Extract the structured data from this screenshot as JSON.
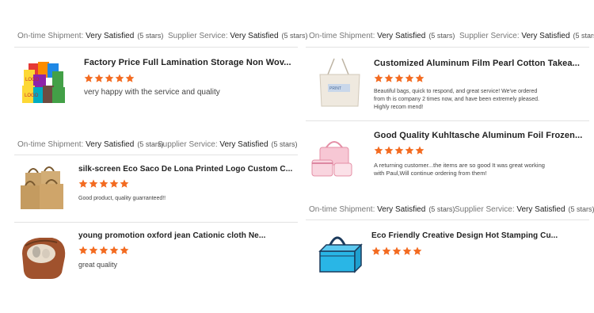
{
  "star_color": "#f36b21",
  "sat_labels": {
    "ontime": "On-time Shipment:",
    "supplier": "Supplier Service:",
    "value": "Very Satisfied",
    "count": "(5 stars)"
  },
  "left": {
    "cards": [
      {
        "title": "Factory Price Full Lamination Storage Non Wov...",
        "rating": 5,
        "review": "very happy with the service and quality",
        "icon": "colorful-tote-bags-image"
      },
      {
        "title": "silk-screen Eco Saco De Lona Printed Logo Custom C...",
        "rating": 5,
        "review": "Good product, quality guarranteed!!",
        "icon": "jute-bags-image"
      },
      {
        "title": "young promotion oxford jean Cationic cloth Ne...",
        "rating": 5,
        "review": "great quality",
        "icon": "cosmetic-pouch-image"
      }
    ]
  },
  "right": {
    "cards": [
      {
        "title": "Customized Aluminum Film Pearl Cotton Takea...",
        "rating": 5,
        "review": "Beautiful bags, quick to respond, and great service! We've ordered from th is company 2 times now, and have been extremely pleased. Highly recom mend!",
        "icon": "canvas-tote-image"
      },
      {
        "title": "Good Quality Kuhltasche Aluminum Foil Frozen...",
        "rating": 5,
        "review": "A returning customer...the items are so good It was great working with Paul,Will continue ordering from them!",
        "icon": "pink-cooler-bags-image"
      },
      {
        "title": "Eco Friendly Creative Design Hot Stamping Cu...",
        "rating": 5,
        "review": "",
        "icon": "blue-cooler-bag-image"
      }
    ]
  }
}
